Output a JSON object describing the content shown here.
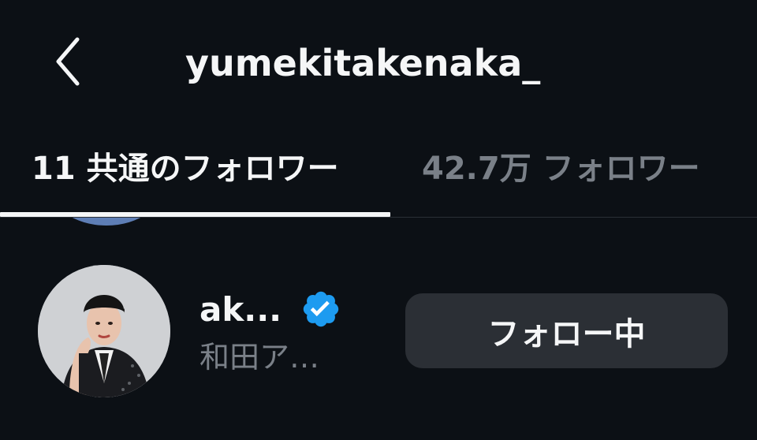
{
  "header": {
    "back_icon": "chevron-left-icon",
    "title": "yumekitakenaka_"
  },
  "tabs": [
    {
      "label": "11 共通のフォロワー",
      "active": true
    },
    {
      "label": "42.7万 フォロワー",
      "active": false
    }
  ],
  "list": {
    "items": [
      {
        "display_name": "ak...",
        "handle": "和田ア…",
        "verified": true,
        "follow_label": "フォロー中"
      }
    ]
  },
  "colors": {
    "background": "#0c1015",
    "verified": "#1d9bf0",
    "button_bg": "#2b2f35",
    "muted_text": "#7a8088"
  }
}
